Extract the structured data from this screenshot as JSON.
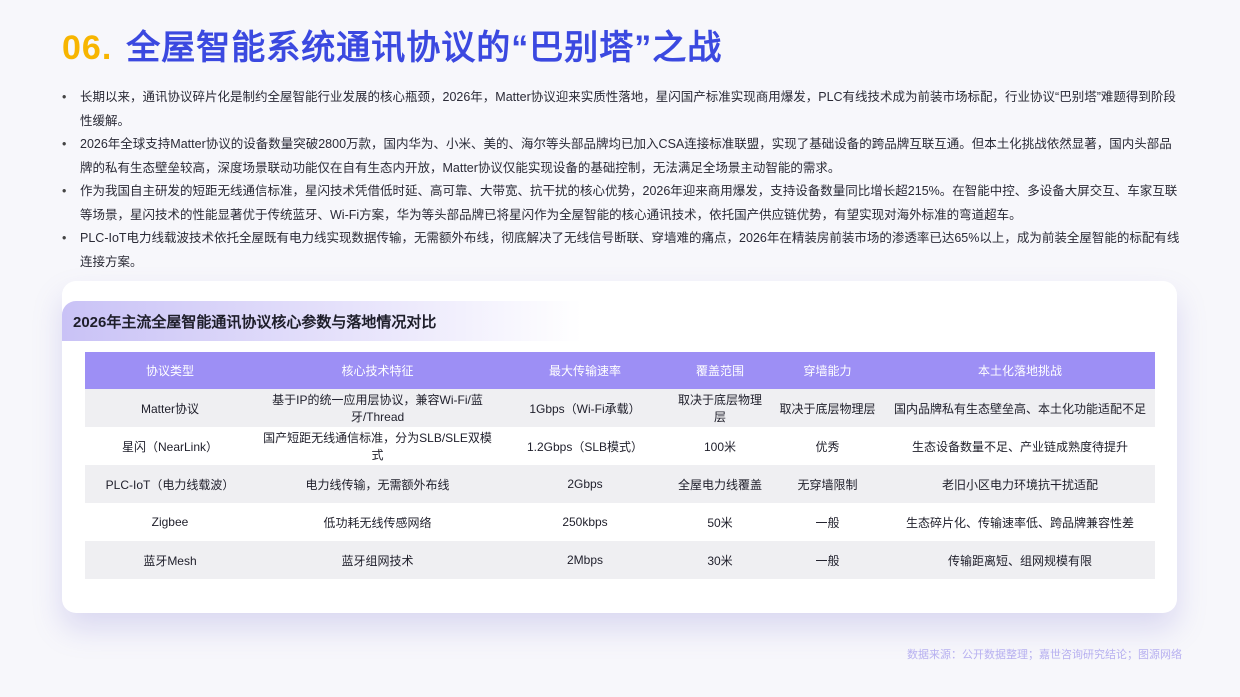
{
  "header": {
    "number": "06.",
    "title": "全屋智能系统通讯协议的“巴别塔”之战"
  },
  "bullets": [
    "长期以来，通讯协议碎片化是制约全屋智能行业发展的核心瓶颈，2026年，Matter协议迎来实质性落地，星闪国产标准实现商用爆发，PLC有线技术成为前装市场标配，行业协议“巴别塔”难题得到阶段性缓解。",
    "2026年全球支持Matter协议的设备数量突破2800万款，国内华为、小米、美的、海尔等头部品牌均已加入CSA连接标准联盟，实现了基础设备的跨品牌互联互通。但本土化挑战依然显著，国内头部品牌的私有生态壁垒较高，深度场景联动功能仅在自有生态内开放，Matter协议仅能实现设备的基础控制，无法满足全场景主动智能的需求。",
    "作为我国自主研发的短距无线通信标准，星闪技术凭借低时延、高可靠、大带宽、抗干扰的核心优势，2026年迎来商用爆发，支持设备数量同比增长超215%。在智能中控、多设备大屏交互、车家互联等场景，星闪技术的性能显著优于传统蓝牙、Wi-Fi方案，华为等头部品牌已将星闪作为全屋智能的核心通讯技术，依托国产供应链优势，有望实现对海外标准的弯道超车。",
    "PLC-IoT电力线载波技术依托全屋既有电力线实现数据传输，无需额外布线，彻底解决了无线信号断联、穿墙难的痛点，2026年在精装房前装市场的渗透率已达65%以上，成为前装全屋智能的标配有线连接方案。"
  ],
  "card": {
    "title": "2026年主流全屋智能通讯协议核心参数与落地情况对比"
  },
  "table": {
    "headers": [
      "协议类型",
      "核心技术特征",
      "最大传输速率",
      "覆盖范围",
      "穿墙能力",
      "本土化落地挑战"
    ],
    "rows": [
      [
        "Matter协议",
        "基于IP的统一应用层协议，兼容Wi-Fi/蓝牙/Thread",
        "1Gbps（Wi-Fi承载）",
        "取决于底层物理层",
        "取决于底层物理层",
        "国内品牌私有生态壁垒高、本土化功能适配不足"
      ],
      [
        "星闪（NearLink）",
        "国产短距无线通信标准，分为SLB/SLE双模式",
        "1.2Gbps（SLB模式）",
        "100米",
        "优秀",
        "生态设备数量不足、产业链成熟度待提升"
      ],
      [
        "PLC-IoT（电力线载波）",
        "电力线传输，无需额外布线",
        "2Gbps",
        "全屋电力线覆盖",
        "无穿墙限制",
        "老旧小区电力环境抗干扰适配"
      ],
      [
        "Zigbee",
        "低功耗无线传感网络",
        "250kbps",
        "50米",
        "一般",
        "生态碎片化、传输速率低、跨品牌兼容性差"
      ],
      [
        "蓝牙Mesh",
        "蓝牙组网技术",
        "2Mbps",
        "30米",
        "一般",
        "传输距离短、组网规模有限"
      ]
    ]
  },
  "footer": {
    "source": "数据来源：公开数据整理；嘉世咨询研究结论；图源网络"
  }
}
